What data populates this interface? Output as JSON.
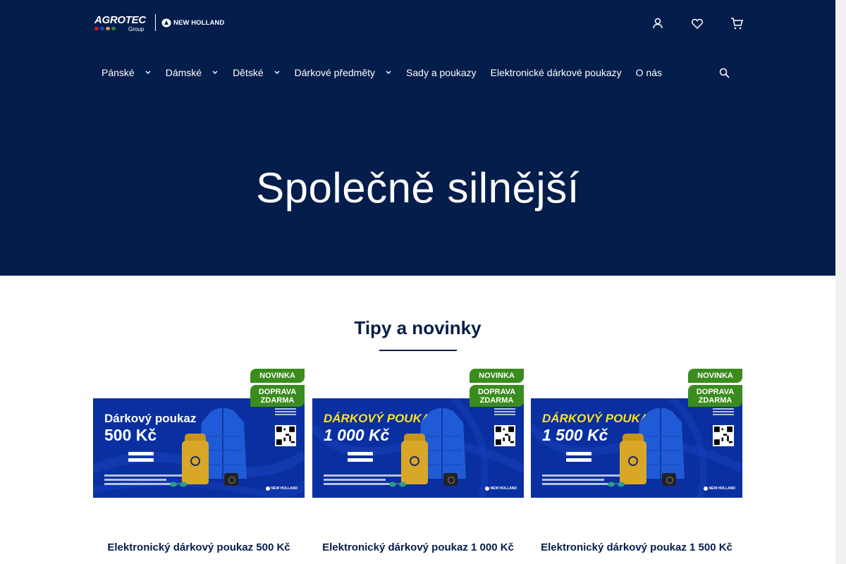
{
  "header": {
    "logo": {
      "agrotec": "AGROTEC",
      "group": "Group",
      "new_holland": "NEW HOLLAND"
    },
    "icons": [
      "user-icon",
      "heart-icon",
      "cart-icon",
      "search-icon"
    ]
  },
  "nav": {
    "items": [
      {
        "label": "Pánské",
        "has_dropdown": true
      },
      {
        "label": "Dámské",
        "has_dropdown": true
      },
      {
        "label": "Dětské",
        "has_dropdown": true
      },
      {
        "label": "Dárkové předměty",
        "has_dropdown": true
      },
      {
        "label": "Sady a poukazy",
        "has_dropdown": false
      },
      {
        "label": "Elektronické dárkové poukazy",
        "has_dropdown": false
      },
      {
        "label": "O nás",
        "has_dropdown": false
      }
    ]
  },
  "hero": {
    "title": "Společně silnější",
    "background_color": "#051d4b"
  },
  "section": {
    "title": "Tipy a novinky"
  },
  "products": [
    {
      "name": "Elektronický dárkový poukaz 500 Kč",
      "badge_new": "NOVINKA",
      "badge_shipping": "DOPRAVA ZDARMA",
      "voucher_line1": "Dárkový poukaz",
      "voucher_line2": "500 Kč",
      "italic_style": false
    },
    {
      "name": "Elektronický dárkový poukaz 1 000 Kč",
      "badge_new": "NOVINKA",
      "badge_shipping": "DOPRAVA ZDARMA",
      "voucher_line1": "DÁRKOVÝ POUKAZ",
      "voucher_line2": "1 000 Kč",
      "italic_style": true
    },
    {
      "name": "Elektronický dárkový poukaz 1 500 Kč",
      "badge_new": "NOVINKA",
      "badge_shipping": "DOPRAVA ZDARMA",
      "voucher_line1": "DÁRKOVÝ POUKAZ",
      "voucher_line2": "1 500 Kč",
      "italic_style": true
    }
  ],
  "colors": {
    "navy": "#051d4b",
    "badge_green": "#3a8c1e",
    "voucher_blue": "#0a2fa0",
    "accent_yellow": "#ffe21f"
  }
}
